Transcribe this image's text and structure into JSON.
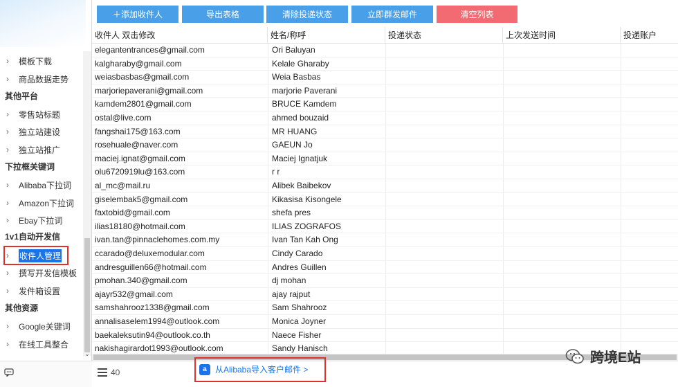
{
  "toolbar": {
    "add_recipient": "＋添加收件人",
    "export_table": "导出表格",
    "clear_status": "清除投递状态",
    "send_now": "立即群发邮件",
    "clear_list": "清空列表"
  },
  "sidebar": {
    "items_top": [
      {
        "label": "模板下载"
      },
      {
        "label": "商品数据走势"
      }
    ],
    "group_other_platforms": "其他平台",
    "items_platforms": [
      {
        "label": "零售站标题"
      },
      {
        "label": "独立站建设"
      },
      {
        "label": "独立站推广"
      }
    ],
    "group_dropdown": "下拉框关键词",
    "items_dropdown": [
      {
        "label": "Alibaba下拉词"
      },
      {
        "label": "Amazon下拉词"
      },
      {
        "label": "Ebay下拉词"
      }
    ],
    "group_1v1": "1v1自动开发信",
    "items_1v1": [
      {
        "label": "收件人管理"
      },
      {
        "label": "撰写开发信模板"
      },
      {
        "label": "发件箱设置"
      }
    ],
    "group_resources": "其他资源",
    "items_resources": [
      {
        "label": "Google关键词"
      },
      {
        "label": "在线工具整合"
      }
    ]
  },
  "table": {
    "headers": [
      "收件人 双击修改",
      "姓名/称呼",
      "投递状态",
      "上次发送时间",
      "投递账户"
    ],
    "rows": [
      {
        "email": "elegantentrances@gmail.com",
        "name": "Ori Baluyan"
      },
      {
        "email": "kalgharaby@gmail.com",
        "name": "Kelale Gharaby"
      },
      {
        "email": "weiasbasbas@gmail.com",
        "name": "Weia Basbas"
      },
      {
        "email": "marjoriepaverani@gmail.com",
        "name": "marjorie Paverani"
      },
      {
        "email": "kamdem2801@gmail.com",
        "name": "BRUCE Kamdem"
      },
      {
        "email": "ostal@live.com",
        "name": "ahmed bouzaid"
      },
      {
        "email": "fangshai175@163.com",
        "name": "MR HUANG"
      },
      {
        "email": "rosehuale@naver.com",
        "name": "GAEUN Jo"
      },
      {
        "email": "maciej.ignat@gmail.com",
        "name": "Maciej Ignatjuk"
      },
      {
        "email": "olu6720919lu@163.com",
        "name": "r r"
      },
      {
        "email": "al_mc@mail.ru",
        "name": "Alibek Baibekov"
      },
      {
        "email": "giselembak5@gmail.com",
        "name": "Kikasisa Kisongele"
      },
      {
        "email": "faxtobid@gmail.com",
        "name": "shefa pres"
      },
      {
        "email": "ilias18180@hotmail.com",
        "name": "ILIAS ZOGRAFOS"
      },
      {
        "email": "ivan.tan@pinnaclehomes.com.my",
        "name": "Ivan Tan Kah Ong"
      },
      {
        "email": "ccarado@deluxemodular.com",
        "name": "Cindy Carado"
      },
      {
        "email": "andresguillen66@hotmail.com",
        "name": "Andres Guillen"
      },
      {
        "email": "pmohan.340@gmail.com",
        "name": "dj mohan"
      },
      {
        "email": "ajayr532@gmail.com",
        "name": "ajay rajput"
      },
      {
        "email": "samshahrooz1338@gmail.com",
        "name": "Sam Shahrooz"
      },
      {
        "email": "annalisaselem1994@outlook.com",
        "name": "Monica Joyner"
      },
      {
        "email": "baekaleksutin94@outlook.co.th",
        "name": "Naece Fisher"
      },
      {
        "email": "nakishagirardot1993@outlook.com",
        "name": "Sandy Hanisch"
      }
    ]
  },
  "footer": {
    "count": "40",
    "import_link": "从Alibaba导入客户邮件 >"
  },
  "watermark": {
    "text": "跨境E站"
  },
  "colors": {
    "toolbar_blue": "#4aa0e8",
    "toolbar_red": "#f26b73",
    "selection_blue": "#1a73e8",
    "highlight_red": "#e0302a"
  }
}
